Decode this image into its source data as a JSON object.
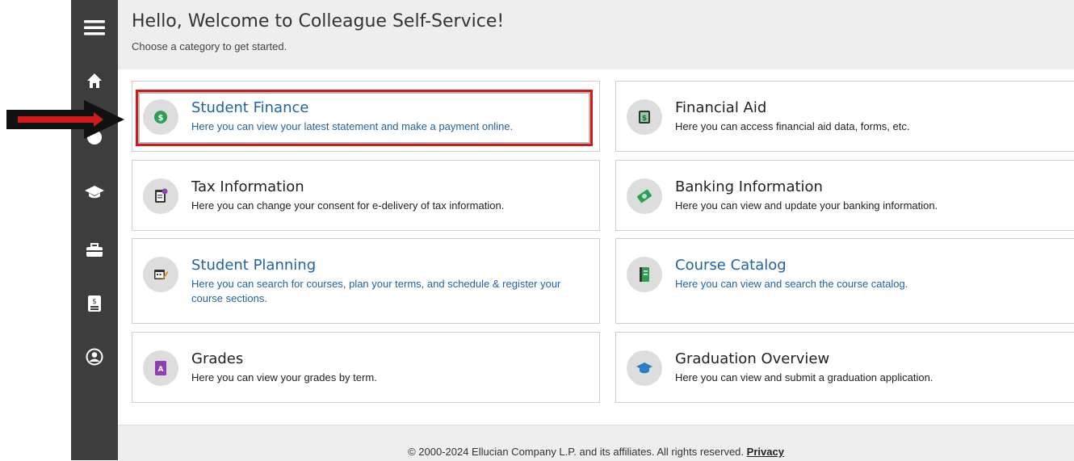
{
  "header": {
    "title": "Hello, Welcome to Colleague Self-Service!",
    "subtitle": "Choose a category to get started."
  },
  "sidebar": {
    "items": [
      {
        "icon": "menu-icon"
      },
      {
        "icon": "home-icon"
      },
      {
        "icon": "dollar-icon"
      },
      {
        "icon": "graduation-cap-icon"
      },
      {
        "icon": "briefcase-icon"
      },
      {
        "icon": "document-icon"
      },
      {
        "icon": "user-icon"
      }
    ]
  },
  "cards": [
    {
      "title": "Student Finance",
      "desc": "Here you can view your latest statement and make a payment online.",
      "icon": "dollar-coin-icon",
      "link": true
    },
    {
      "title": "Financial Aid",
      "desc": "Here you can access financial aid data, forms, etc.",
      "icon": "money-document-icon",
      "link": false
    },
    {
      "title": "Tax Information",
      "desc": "Here you can change your consent for e-delivery of tax information.",
      "icon": "tax-form-icon",
      "link": false
    },
    {
      "title": "Banking Information",
      "desc": "Here you can view and update your banking information.",
      "icon": "money-bag-icon",
      "link": false
    },
    {
      "title": "Student Planning",
      "desc": "Here you can search for courses, plan your terms, and schedule & register your course sections.",
      "icon": "calendar-edit-icon",
      "link": true
    },
    {
      "title": "Course Catalog",
      "desc": "Here you can view and search the course catalog.",
      "icon": "book-icon",
      "link": true
    },
    {
      "title": "Grades",
      "desc": "Here you can view your grades by term.",
      "icon": "grade-a-icon",
      "link": false
    },
    {
      "title": "Graduation Overview",
      "desc": "Here you can view and submit a graduation application.",
      "icon": "graduation-cap-icon",
      "link": false
    }
  ],
  "footer": {
    "copyright": "© 2000-2024 Ellucian Company L.P. and its affiliates. All rights reserved.",
    "privacy_label": "Privacy"
  },
  "colors": {
    "sidebar": "#3d3d3d",
    "link": "#1f63a3",
    "highlight": "#d11a1a",
    "header_bg": "#eeeeee"
  }
}
